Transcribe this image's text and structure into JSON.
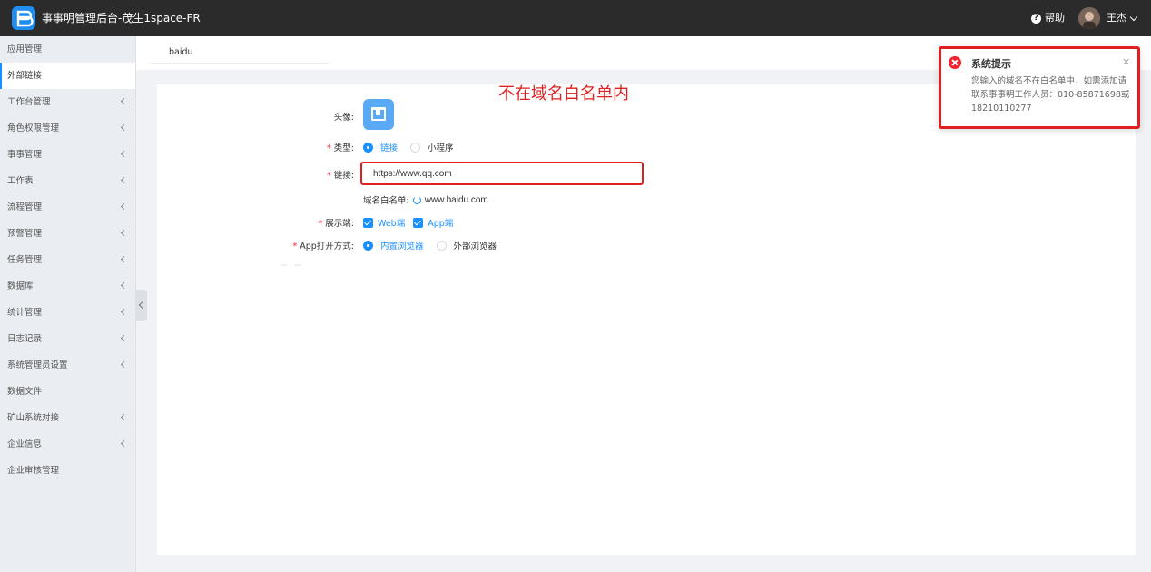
{
  "header": {
    "app_title": "事事明管理后台-茂生1space-FR",
    "help_label": "帮助",
    "help_icon": "question-circle-icon",
    "user_name": "王杰"
  },
  "sidebar": {
    "items": [
      {
        "label": "应用管理",
        "has_arrow": false
      },
      {
        "label": "外部链接",
        "has_arrow": false,
        "active": true
      },
      {
        "label": "工作台管理",
        "has_arrow": true
      },
      {
        "label": "角色权限管理",
        "has_arrow": true
      },
      {
        "label": "事事管理",
        "has_arrow": true
      },
      {
        "label": "工作表",
        "has_arrow": true
      },
      {
        "label": "流程管理",
        "has_arrow": true
      },
      {
        "label": "预警管理",
        "has_arrow": true
      },
      {
        "label": "任务管理",
        "has_arrow": true
      },
      {
        "label": "数据库",
        "has_arrow": true
      },
      {
        "label": "统计管理",
        "has_arrow": true
      },
      {
        "label": "日志记录",
        "has_arrow": true
      },
      {
        "label": "系统管理员设置",
        "has_arrow": true
      },
      {
        "label": "数据文件",
        "has_arrow": false
      },
      {
        "label": "矿山系统对接",
        "has_arrow": true
      },
      {
        "label": "企业信息",
        "has_arrow": true
      },
      {
        "label": "企业审核管理",
        "has_arrow": false
      }
    ]
  },
  "tabs": {
    "active_label": "baidu"
  },
  "form": {
    "avatar_label": "头像:",
    "type_label": "类型:",
    "type_options": [
      "链接",
      "小程序"
    ],
    "type_selected": "链接",
    "link_label": "链接:",
    "link_value": "https://www.qq.com",
    "whitelist_label": "域名白名单:",
    "whitelist_value": "www.baidu.com",
    "display_label": "展示端:",
    "display_options": [
      "Web端",
      "App端"
    ],
    "open_mode_label": "App打开方式:",
    "open_mode_options": [
      "内置浏览器",
      "外部浏览器"
    ],
    "open_mode_selected": "内置浏览器"
  },
  "annotation": {
    "text": "不在域名白名单内",
    "color": "#e02020"
  },
  "notification": {
    "title": "系统提示",
    "message": "您输入的域名不在白名单中，如需添加请联系事事明工作人员：010-85871698或18210110277",
    "icon": "error-circle-icon",
    "close_icon": "close-icon"
  },
  "colors": {
    "topbar": "#2b2b2b",
    "accent": "#1890ff",
    "error": "#f5222d",
    "highlight": "#e02020"
  }
}
